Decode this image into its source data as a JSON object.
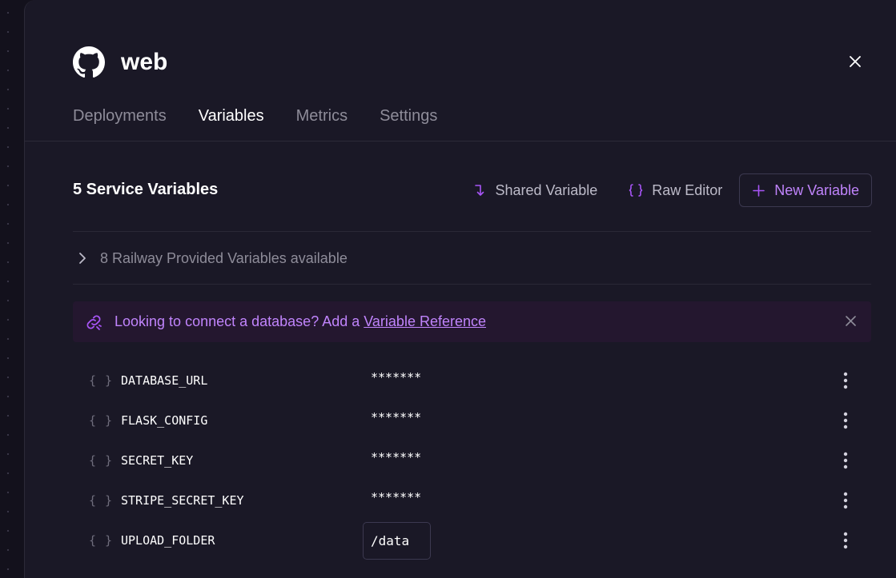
{
  "service": {
    "name": "web"
  },
  "tabs": [
    "Deployments",
    "Variables",
    "Metrics",
    "Settings"
  ],
  "active_tab": "Variables",
  "section_title": "5 Service Variables",
  "actions": {
    "shared_variable": "Shared Variable",
    "raw_editor": "Raw Editor",
    "new_variable": "New Variable"
  },
  "provided_variables": "8 Railway Provided Variables available",
  "banner": {
    "text": "Looking to connect a database? Add a",
    "link": "Variable Reference"
  },
  "variables": [
    {
      "name": "DATABASE_URL",
      "value": "*******"
    },
    {
      "name": "FLASK_CONFIG",
      "value": "*******"
    },
    {
      "name": "SECRET_KEY",
      "value": "*******"
    },
    {
      "name": "STRIPE_SECRET_KEY",
      "value": "*******"
    },
    {
      "name": "UPLOAD_FOLDER",
      "value": "/data"
    }
  ],
  "variable_icon": "{ }",
  "colors": {
    "accent": "#a855f7",
    "accent_text": "#c084fc",
    "panel_bg": "#1a1826",
    "banner_bg": "#24172f"
  }
}
